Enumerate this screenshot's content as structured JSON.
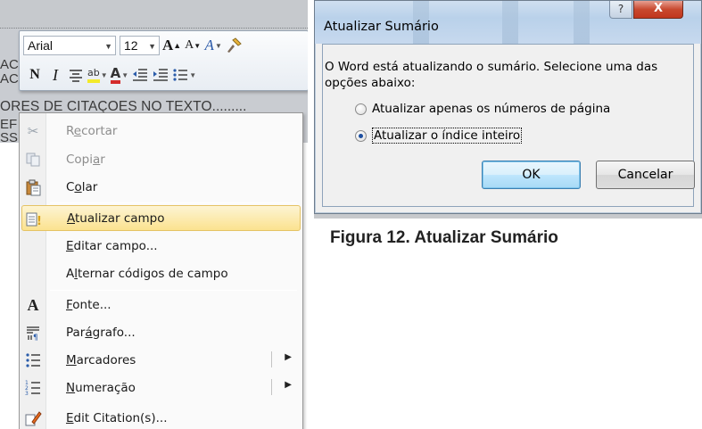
{
  "document": {
    "line1": "AC",
    "line2": "AC",
    "line3": "ORES DE CITAÇOES NO TEXTO",
    "line3_dots": ".........",
    "line4": "EF",
    "line5": "SS"
  },
  "mini_toolbar": {
    "font_name": "Arial",
    "font_size": "12",
    "grow_font": "A",
    "shrink_font": "A",
    "styles": "A",
    "bold": "N",
    "italic": "I",
    "font_color": "A",
    "highlight": "ab"
  },
  "context_menu": {
    "items": [
      {
        "label": "Recortar",
        "accel": "e",
        "disabled": true
      },
      {
        "label": "Copiar",
        "accel": "i",
        "disabled": true
      },
      {
        "label": "Colar",
        "accel": "o",
        "disabled": false
      },
      {
        "label": "Atualizar campo",
        "accel": "A",
        "disabled": false,
        "highlighted": true
      },
      {
        "label": "Editar campo...",
        "accel": "E",
        "disabled": false
      },
      {
        "label": "Alternar códigos de campo",
        "accel": "l",
        "disabled": false
      },
      {
        "label": "Fonte...",
        "accel": "F",
        "disabled": false
      },
      {
        "label": "Parágrafo...",
        "accel": "g",
        "disabled": false
      },
      {
        "label": "Marcadores",
        "accel": "M",
        "disabled": false,
        "submenu": true
      },
      {
        "label": "Numeração",
        "accel": "N",
        "disabled": false,
        "submenu": true
      },
      {
        "label": "Edit Citation(s)...",
        "accel": "E",
        "disabled": false
      }
    ]
  },
  "dialog": {
    "title": "Atualizar Sumário",
    "help": "?",
    "close": "X",
    "message": "O Word está atualizando o sumário. Selecione uma das opções abaixo:",
    "option1": "Atualizar apenas os números de página",
    "option2": "Atualizar o índice inteiro",
    "selected": 2,
    "ok": "OK",
    "cancel": "Cancelar"
  },
  "caption": "Figura 12. Atualizar Sumário",
  "colors": {
    "highlight_top": "#fdf4d3",
    "highlight_bottom": "#fbe28f",
    "close_red": "#c8492f",
    "ok_border": "#3c7fb1"
  }
}
